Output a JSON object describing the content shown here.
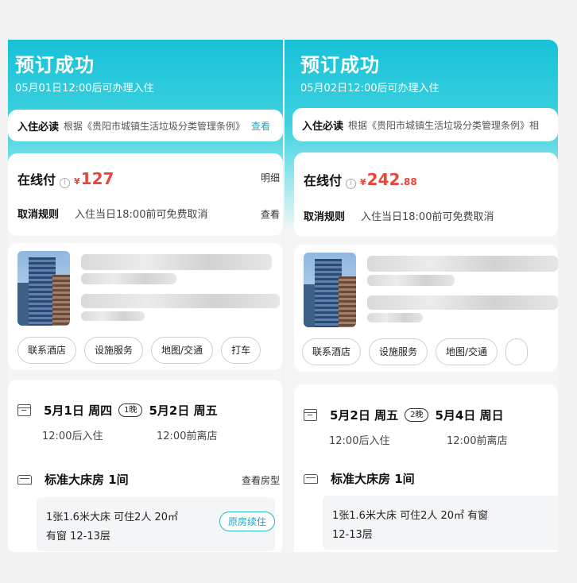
{
  "left": {
    "header": {
      "title": "预订成功",
      "subtitle": "05月01日12:00后可办理入住"
    },
    "notice": {
      "label": "入住必读",
      "text": "根据《贵阳市城镇生活垃圾分类管理条例》",
      "more": "查看"
    },
    "payment": {
      "label": "在线付",
      "currency": "¥",
      "amount": "127",
      "decimal": "",
      "detail_link": "明细",
      "cancel_label": "取消规则",
      "cancel_text": "入住当日18:00前可免费取消",
      "view_link": "查看"
    },
    "hotel": {
      "buttons": [
        "联系酒店",
        "设施服务",
        "地图/交通",
        "打车"
      ]
    },
    "stay": {
      "checkin_date": "5月1日 周四",
      "nights": "1晚",
      "checkout_date": "5月2日 周五",
      "checkin_time": "12:00后入住",
      "checkout_time": "12:00前离店",
      "room_name": "标准大床房  1间",
      "room_type_link": "查看房型",
      "detail_line1": "1张1.6米大床  可住2人  20㎡",
      "detail_line2": "有窗  12-13层",
      "renew_button": "原房续住"
    }
  },
  "right": {
    "header": {
      "title": "预订成功",
      "subtitle": "05月02日12:00后可办理入住"
    },
    "notice": {
      "label": "入住必读",
      "text": "根据《贵阳市城镇生活垃圾分类管理条例》相"
    },
    "payment": {
      "label": "在线付",
      "currency": "¥",
      "amount": "242",
      "decimal": ".88",
      "cancel_label": "取消规则",
      "cancel_text": "入住当日18:00前可免费取消"
    },
    "hotel": {
      "buttons": [
        "联系酒店",
        "设施服务",
        "地图/交通"
      ]
    },
    "stay": {
      "checkin_date": "5月2日 周五",
      "nights": "2晚",
      "checkout_date": "5月4日 周日",
      "checkin_time": "12:00后入住",
      "checkout_time": "12:00前离店",
      "room_name": "标准大床房  1间",
      "detail_line1": "1张1.6米大床  可住2人  20㎡  有窗",
      "detail_line2": "12-13层"
    }
  }
}
